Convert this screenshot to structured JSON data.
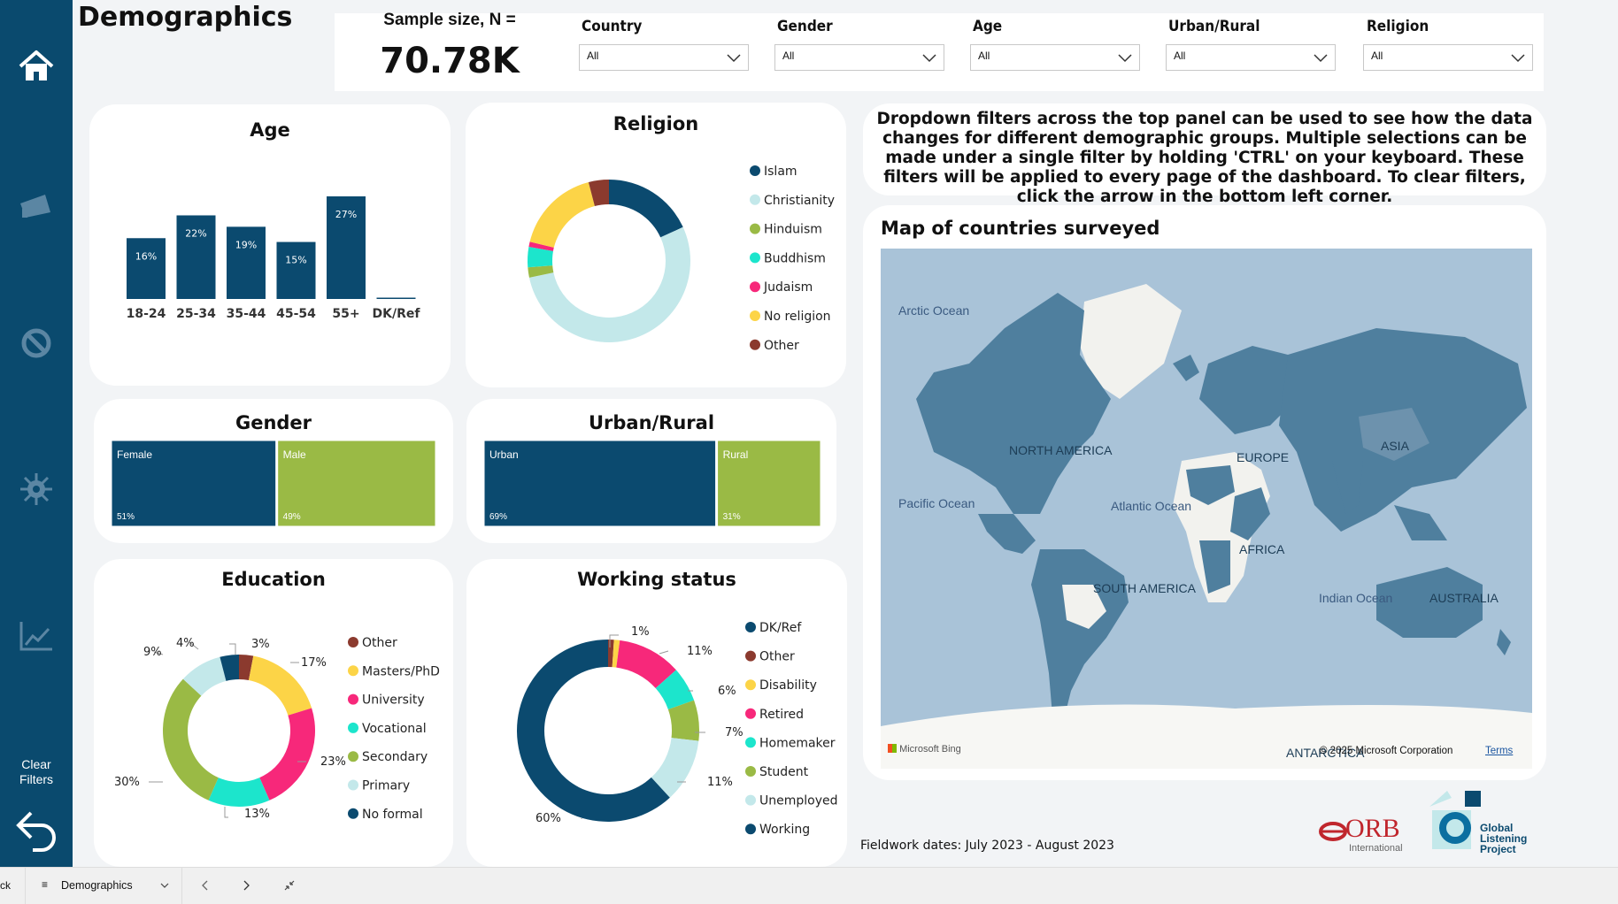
{
  "page": {
    "title": "Demographics"
  },
  "nav": {
    "items": [
      {
        "icon": "home-icon"
      },
      {
        "icon": "megaphone-icon"
      },
      {
        "icon": "prohibited-icon"
      },
      {
        "icon": "virus-icon"
      },
      {
        "icon": "trend-chart-icon"
      }
    ],
    "clear_label": "Clear Filters",
    "back_icon": "undo-arrow-icon"
  },
  "sample": {
    "label": "Sample size, N =",
    "value": "70.78K"
  },
  "filters": [
    {
      "label": "Country",
      "value": "All"
    },
    {
      "label": "Gender",
      "value": "All"
    },
    {
      "label": "Age",
      "value": "All"
    },
    {
      "label": "Urban/Rural",
      "value": "All"
    },
    {
      "label": "Religion",
      "value": "All"
    }
  ],
  "info": {
    "text": "Dropdown filters across the top panel can be used to see how the data changes for different demographic groups. Multiple selections can be made under a single filter by holding 'CTRL' on your keyboard. These filters will be applied to every page of the dashboard. To clear filters, click the arrow in the bottom left corner."
  },
  "map": {
    "title": "Map of countries surveyed",
    "oceans": [
      "Arctic Ocean",
      "Pacific Ocean",
      "Atlantic Ocean",
      "Indian Ocean"
    ],
    "continents": [
      "NORTH AMERICA",
      "EUROPE",
      "ASIA",
      "AFRICA",
      "SOUTH AMERICA",
      "AUSTRALIA",
      "ANTARCTICA"
    ],
    "bing": "Microsoft Bing",
    "copyright": "© 2025 Microsoft Corporation",
    "terms": "Terms"
  },
  "fieldwork": "Fieldwork dates: July 2023 - August 2023",
  "logos": {
    "orb": "ORB",
    "orb_sub": "International",
    "glp": "Global Listening Project"
  },
  "bottom_bar": {
    "back": "ck",
    "page": "Demographics"
  },
  "colors": {
    "navy": "#0b4a6f",
    "green": "#9aba45",
    "nav_bg": "#0a4a6e"
  },
  "chart_data": [
    {
      "type": "bar",
      "title": "Age",
      "categories": [
        "18-24",
        "25-34",
        "35-44",
        "45-54",
        "55+",
        "DK/Ref"
      ],
      "values": [
        16,
        22,
        19,
        15,
        27,
        0
      ],
      "labels": [
        "16%",
        "22%",
        "19%",
        "15%",
        "27%",
        ""
      ]
    },
    {
      "type": "pie",
      "title": "Religion",
      "labels": [
        "Islam",
        "Christianity",
        "Hinduism",
        "Buddhism",
        "Judaism",
        "No religion",
        "Other"
      ],
      "values": [
        18,
        53,
        2,
        4,
        1,
        17,
        4
      ],
      "colors": [
        "#0b4a6f",
        "#c3e8ea",
        "#9aba45",
        "#1ce5cc",
        "#f7287a",
        "#fcd447",
        "#8b3a2e"
      ]
    },
    {
      "type": "bar",
      "title": "Gender",
      "categories": [
        "Female",
        "Male"
      ],
      "values": [
        51,
        49
      ],
      "labels": [
        "51%",
        "49%"
      ]
    },
    {
      "type": "bar",
      "title": "Urban/Rural",
      "categories": [
        "Urban",
        "Rural"
      ],
      "values": [
        69,
        31
      ],
      "labels": [
        "69%",
        "31%"
      ]
    },
    {
      "type": "pie",
      "title": "Education",
      "labels": [
        "Other",
        "Masters/PhD",
        "University",
        "Vocational",
        "Secondary",
        "Primary",
        "No formal"
      ],
      "values": [
        3,
        17,
        23,
        13,
        30,
        9,
        4
      ],
      "colors": [
        "#8b3a2e",
        "#fcd447",
        "#f7287a",
        "#1ce5cc",
        "#9aba45",
        "#c3e8ea",
        "#0b4a6f"
      ]
    },
    {
      "type": "pie",
      "title": "Working status",
      "labels": [
        "DK/Ref",
        "Other",
        "Disability",
        "Retired",
        "Homemaker",
        "Student",
        "Unemployed",
        "Working"
      ],
      "values": [
        0,
        1,
        1,
        11,
        6,
        7,
        11,
        60
      ],
      "colors": [
        "#0b4a6f",
        "#8b3a2e",
        "#fcd447",
        "#f7287a",
        "#1ce5cc",
        "#9aba45",
        "#c3e8ea",
        "#0b4a6f"
      ]
    }
  ]
}
